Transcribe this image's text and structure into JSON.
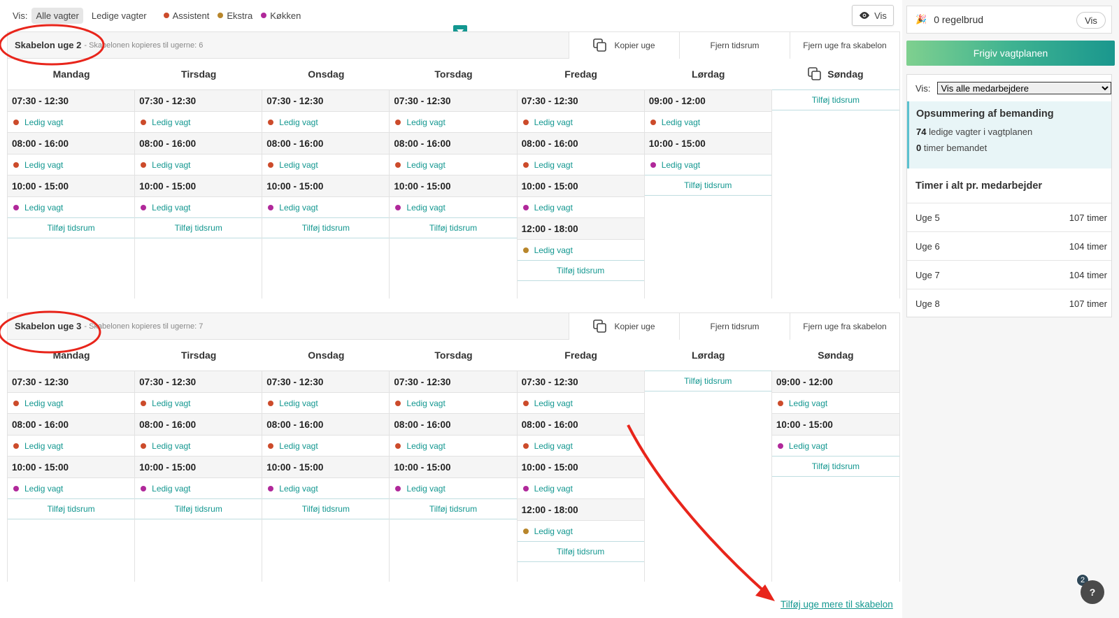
{
  "colors": {
    "assistent": "#cc4b2b",
    "ekstra": "#b8862b",
    "kokken": "#b0289a",
    "accent": "#139790"
  },
  "filter": {
    "label": "Vis:",
    "all_shifts": "Alle vagter",
    "free_shifts": "Ledige vagter",
    "legend": [
      {
        "label": "Assistent",
        "color": "#cc4b2b"
      },
      {
        "label": "Ekstra",
        "color": "#b8862b"
      },
      {
        "label": "Køkken",
        "color": "#b0289a"
      }
    ],
    "vis_button": "Vis"
  },
  "templates": [
    {
      "title": "Skabelon uge 2",
      "subtitle": "- Skabelonen kopieres til ugerne: 6",
      "actions": {
        "copy": "Kopier uge",
        "remove_slot": "Fjern tidsrum",
        "remove_week": "Fjern uge fra skabelon"
      },
      "days": [
        {
          "name": "Mandag",
          "slots": [
            {
              "time": "07:30 - 12:30",
              "shift": "Ledig vagt",
              "type": "assistent"
            },
            {
              "time": "08:00 - 16:00",
              "shift": "Ledig vagt",
              "type": "assistent"
            },
            {
              "time": "10:00 - 15:00",
              "shift": "Ledig vagt",
              "type": "kokken"
            }
          ]
        },
        {
          "name": "Tirsdag",
          "slots": [
            {
              "time": "07:30 - 12:30",
              "shift": "Ledig vagt",
              "type": "assistent"
            },
            {
              "time": "08:00 - 16:00",
              "shift": "Ledig vagt",
              "type": "assistent"
            },
            {
              "time": "10:00 - 15:00",
              "shift": "Ledig vagt",
              "type": "kokken"
            }
          ]
        },
        {
          "name": "Onsdag",
          "slots": [
            {
              "time": "07:30 - 12:30",
              "shift": "Ledig vagt",
              "type": "assistent"
            },
            {
              "time": "08:00 - 16:00",
              "shift": "Ledig vagt",
              "type": "assistent"
            },
            {
              "time": "10:00 - 15:00",
              "shift": "Ledig vagt",
              "type": "kokken"
            }
          ]
        },
        {
          "name": "Torsdag",
          "slots": [
            {
              "time": "07:30 - 12:30",
              "shift": "Ledig vagt",
              "type": "assistent"
            },
            {
              "time": "08:00 - 16:00",
              "shift": "Ledig vagt",
              "type": "assistent"
            },
            {
              "time": "10:00 - 15:00",
              "shift": "Ledig vagt",
              "type": "kokken"
            }
          ]
        },
        {
          "name": "Fredag",
          "slots": [
            {
              "time": "07:30 - 12:30",
              "shift": "Ledig vagt",
              "type": "assistent"
            },
            {
              "time": "08:00 - 16:00",
              "shift": "Ledig vagt",
              "type": "assistent"
            },
            {
              "time": "10:00 - 15:00",
              "shift": "Ledig vagt",
              "type": "kokken"
            },
            {
              "time": "12:00 - 18:00",
              "shift": "Ledig vagt",
              "type": "ekstra"
            }
          ]
        },
        {
          "name": "Lørdag",
          "slots": [
            {
              "time": "09:00 - 12:00",
              "shift": "Ledig vagt",
              "type": "assistent"
            },
            {
              "time": "10:00 - 15:00",
              "shift": "Ledig vagt",
              "type": "kokken"
            }
          ]
        },
        {
          "name": "Søndag",
          "copy_icon": true,
          "slots": []
        }
      ]
    },
    {
      "title": "Skabelon uge 3",
      "subtitle": "- Skabelonen kopieres til ugerne: 7",
      "actions": {
        "copy": "Kopier uge",
        "remove_slot": "Fjern tidsrum",
        "remove_week": "Fjern uge fra skabelon"
      },
      "days": [
        {
          "name": "Mandag",
          "slots": [
            {
              "time": "07:30 - 12:30",
              "shift": "Ledig vagt",
              "type": "assistent"
            },
            {
              "time": "08:00 - 16:00",
              "shift": "Ledig vagt",
              "type": "assistent"
            },
            {
              "time": "10:00 - 15:00",
              "shift": "Ledig vagt",
              "type": "kokken"
            }
          ]
        },
        {
          "name": "Tirsdag",
          "slots": [
            {
              "time": "07:30 - 12:30",
              "shift": "Ledig vagt",
              "type": "assistent"
            },
            {
              "time": "08:00 - 16:00",
              "shift": "Ledig vagt",
              "type": "assistent"
            },
            {
              "time": "10:00 - 15:00",
              "shift": "Ledig vagt",
              "type": "kokken"
            }
          ]
        },
        {
          "name": "Onsdag",
          "slots": [
            {
              "time": "07:30 - 12:30",
              "shift": "Ledig vagt",
              "type": "assistent"
            },
            {
              "time": "08:00 - 16:00",
              "shift": "Ledig vagt",
              "type": "assistent"
            },
            {
              "time": "10:00 - 15:00",
              "shift": "Ledig vagt",
              "type": "kokken"
            }
          ]
        },
        {
          "name": "Torsdag",
          "slots": [
            {
              "time": "07:30 - 12:30",
              "shift": "Ledig vagt",
              "type": "assistent"
            },
            {
              "time": "08:00 - 16:00",
              "shift": "Ledig vagt",
              "type": "assistent"
            },
            {
              "time": "10:00 - 15:00",
              "shift": "Ledig vagt",
              "type": "kokken"
            }
          ]
        },
        {
          "name": "Fredag",
          "slots": [
            {
              "time": "07:30 - 12:30",
              "shift": "Ledig vagt",
              "type": "assistent"
            },
            {
              "time": "08:00 - 16:00",
              "shift": "Ledig vagt",
              "type": "assistent"
            },
            {
              "time": "10:00 - 15:00",
              "shift": "Ledig vagt",
              "type": "kokken"
            },
            {
              "time": "12:00 - 18:00",
              "shift": "Ledig vagt",
              "type": "ekstra"
            }
          ]
        },
        {
          "name": "Lørdag",
          "slots": []
        },
        {
          "name": "Søndag",
          "slots": [
            {
              "time": "09:00 - 12:00",
              "shift": "Ledig vagt",
              "type": "assistent"
            },
            {
              "time": "10:00 - 15:00",
              "shift": "Ledig vagt",
              "type": "kokken"
            }
          ]
        }
      ]
    }
  ],
  "add_slot_label": "Tilføj tidsrum",
  "add_week_link": "Tilføj uge mere til skabelon",
  "sidebar": {
    "rules": "0 regelbrud",
    "rules_button": "Vis",
    "release_button": "Frigiv vagtplanen",
    "vis_label": "Vis:",
    "vis_select": "Vis alle medarbejdere",
    "summary_title": "Opsummering af bemanding",
    "free_count": "74",
    "free_text": "ledige vagter i vagtplanen",
    "staffed_count": "0",
    "staffed_text": "timer bemandet",
    "hours_title": "Timer i alt pr. medarbejder",
    "weeks": [
      {
        "week": "Uge 5",
        "hours": "107 timer"
      },
      {
        "week": "Uge 6",
        "hours": "104 timer"
      },
      {
        "week": "Uge 7",
        "hours": "104 timer"
      },
      {
        "week": "Uge 8",
        "hours": "107 timer"
      }
    ]
  },
  "help_badge": "2",
  "help_icon": "question-icon"
}
